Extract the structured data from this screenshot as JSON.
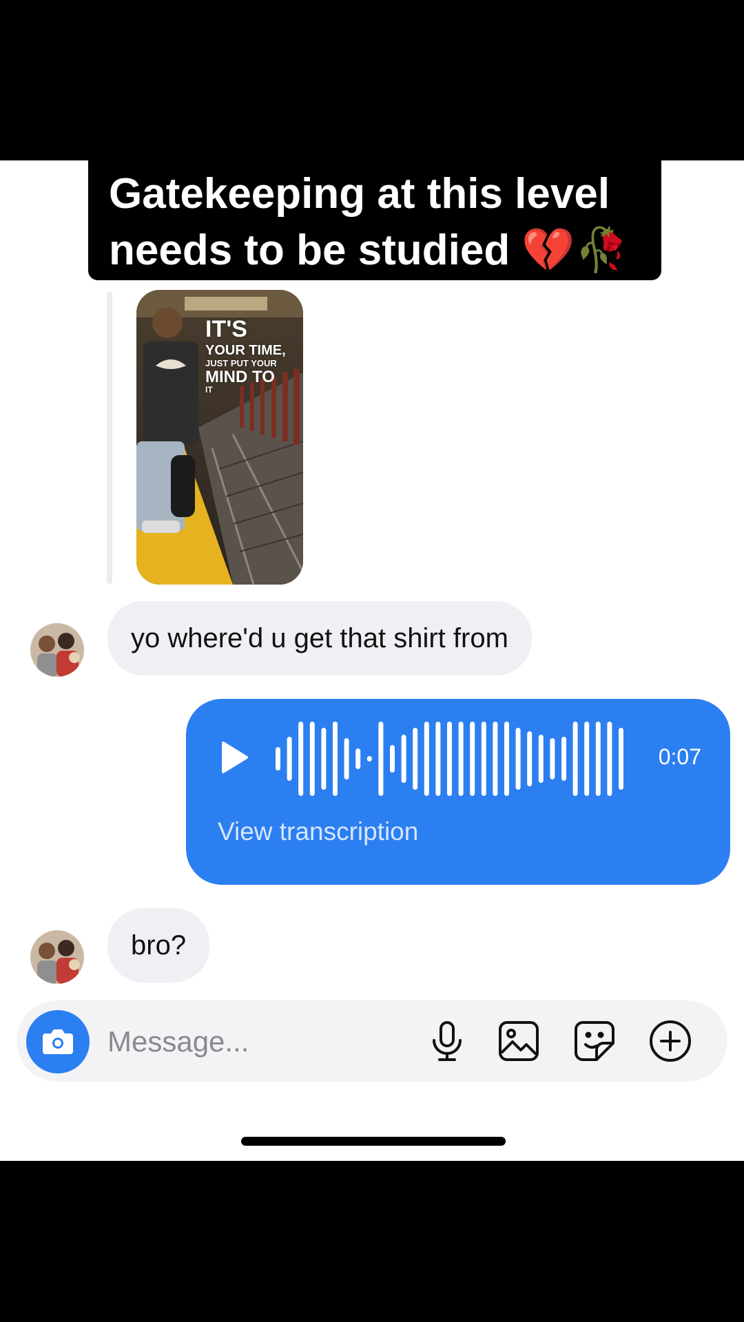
{
  "caption": {
    "line1": "Gatekeeping at this level",
    "line2": "needs to be studied 💔🥀"
  },
  "story": {
    "line1": "IT'S",
    "line2": "YOUR TIME,",
    "line3": "JUST PUT YOUR",
    "line4": "MIND TO",
    "line5": "IT"
  },
  "messages": {
    "msg1": "yo where'd u get that shirt from",
    "msg2": "bro?"
  },
  "voice": {
    "duration": "0:07",
    "transcription_label": "View transcription"
  },
  "composer": {
    "placeholder": "Message..."
  },
  "icons": {
    "play": "play-icon",
    "camera": "camera-icon",
    "mic": "microphone-icon",
    "gallery": "gallery-icon",
    "sticker": "sticker-icon",
    "more": "plus-circle-icon"
  },
  "colors": {
    "accent": "#2b7ff1",
    "incoming_bubble": "#efeff4"
  }
}
